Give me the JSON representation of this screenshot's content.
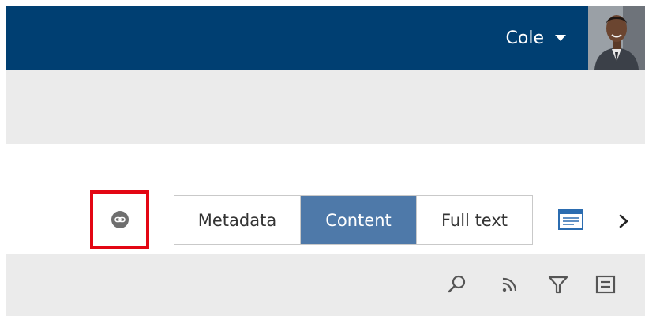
{
  "header": {
    "user_name": "Cole",
    "user_menu_icon": "caret-down-icon",
    "avatar_icon": "user-avatar"
  },
  "toolbar_row": {
    "link_icon": "link-icon",
    "tabs": [
      {
        "label": "Metadata",
        "active": false
      },
      {
        "label": "Content",
        "active": true
      },
      {
        "label": "Full text",
        "active": false
      }
    ],
    "preview_icon": "preview-panel-icon",
    "next_icon": "chevron-right-icon"
  },
  "bottom_toolbar": {
    "icons": [
      "search-icon",
      "rss-feed-icon",
      "filter-icon",
      "list-view-icon"
    ]
  },
  "colors": {
    "header_bg": "#003f72",
    "active_tab_bg": "#4e79a9",
    "highlight_border": "#e30613",
    "panel_bg": "#ebebeb"
  }
}
